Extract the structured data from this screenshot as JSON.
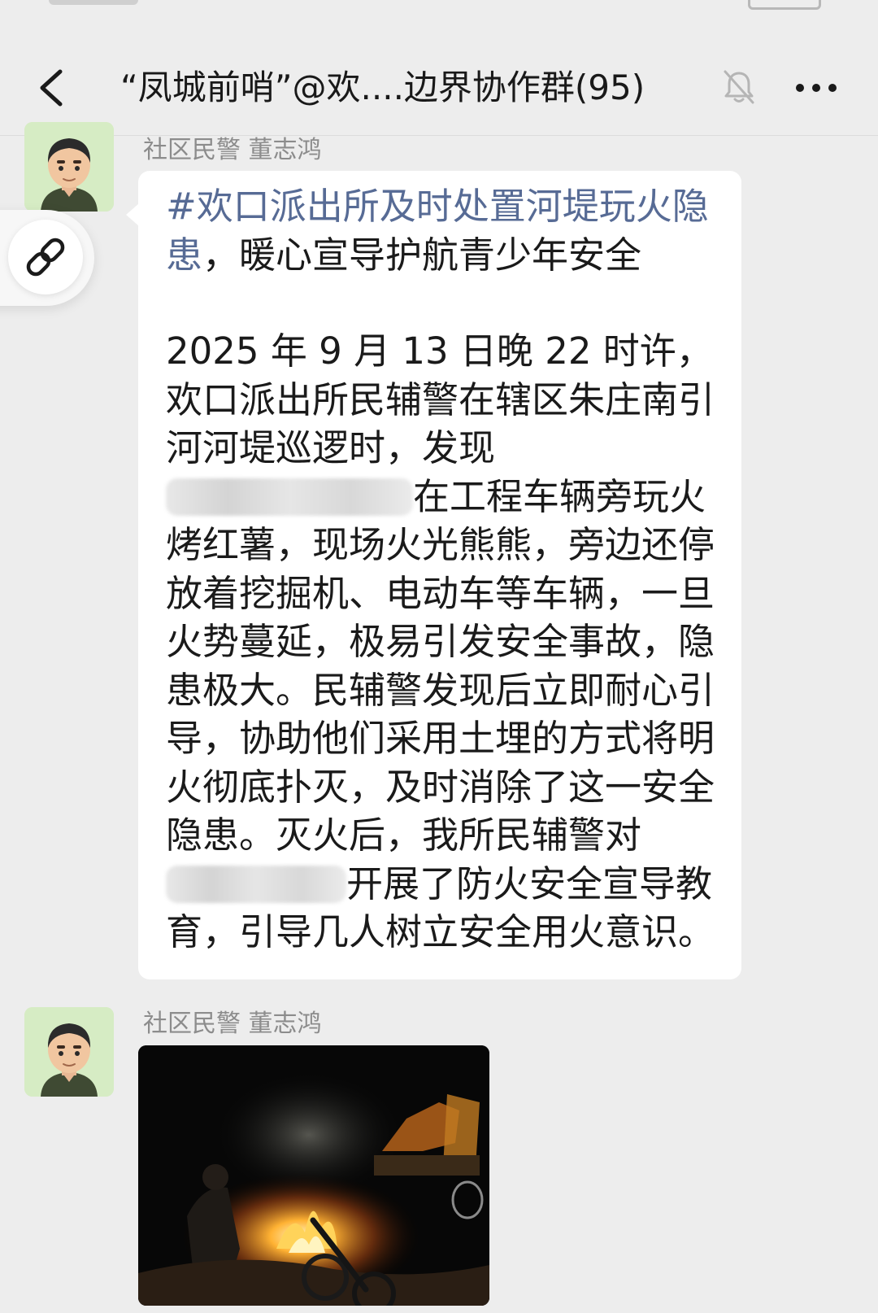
{
  "header": {
    "title": "“凤城前哨”@欢....边界协作群(95)",
    "back_icon": "chevron-left-icon",
    "mute_icon": "bell-off-icon",
    "more_icon": "ellipsis-icon"
  },
  "messages": [
    {
      "sender": "社区民警 董志鸿",
      "type": "text",
      "topic_tag": "#欢口派出所及时处置河堤玩火隐患",
      "topic_rest": "，暖心宣导护航青少年安全",
      "body_a": "2025 年 9 月 13 日晚 22 时许，欢口派出所民辅警在辖区朱庄南引河河堤巡逻时，发现",
      "body_b": "在工程车辆旁玩火烤红薯，现场火光熊熊，旁边还停放着挖掘机、电动车等车辆，一旦火势蔓延，极易引发安全事故，隐患极大。民辅警发现后立即耐心引导，协助他们采用土埋的方式将明火彻底扑灭，及时消除了这一安全隐患。灭火后，我所民辅警对",
      "body_c": "开展了防火安全宣导教育，引导几人树立安全用火意识。"
    },
    {
      "sender": "社区民警 董志鸿",
      "type": "image"
    }
  ],
  "floating": {
    "icon": "link-icon"
  },
  "colors": {
    "background": "#ededed",
    "bubble": "#ffffff",
    "topic_link": "#576b95",
    "sender_name": "#8c8c8c"
  }
}
